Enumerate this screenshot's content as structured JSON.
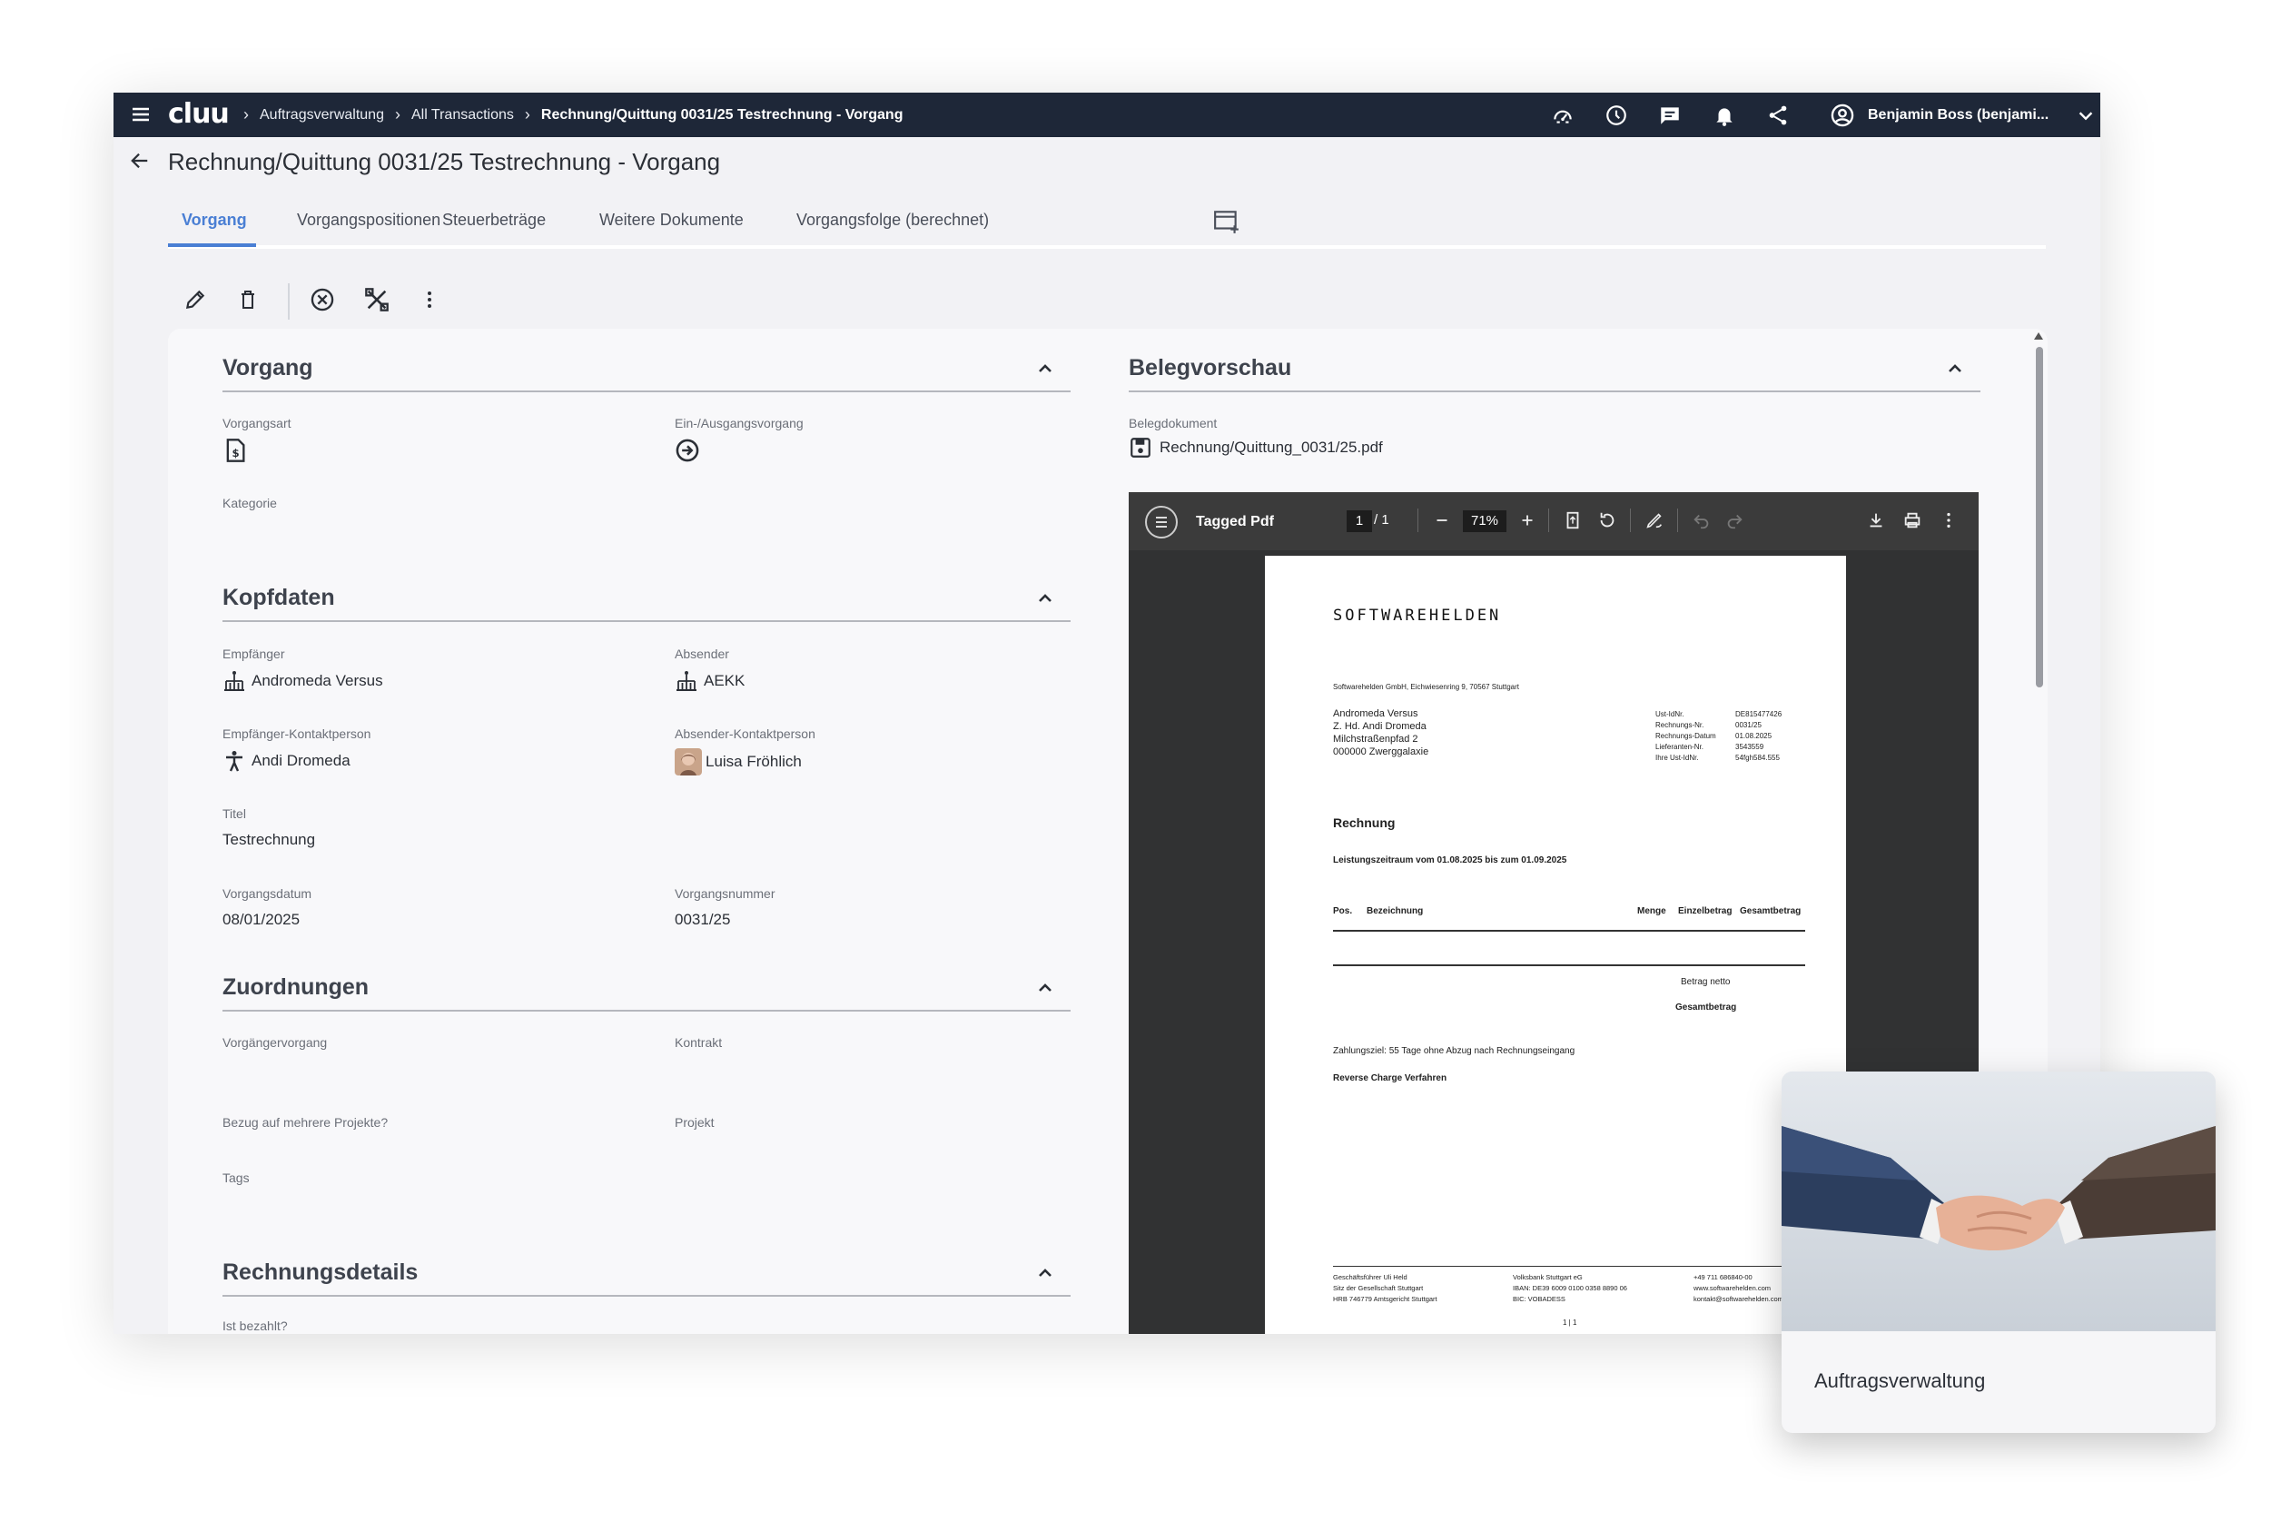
{
  "app": {
    "logo": "cluu",
    "title": "Rechnung/Quittung 0031/25 Testrechnung - Vorgang"
  },
  "breadcrumbs": [
    {
      "label": "Auftragsverwaltung"
    },
    {
      "label": "All Transactions"
    },
    {
      "label": "Rechnung/Quittung 0031/25 Testrechnung - Vorgang"
    }
  ],
  "topbar": {
    "icons": [
      "speedometer-icon",
      "clock-icon",
      "chat-icon",
      "bell-icon",
      "share-icon"
    ],
    "user": "Benjamin Boss (benjami..."
  },
  "tabs": [
    {
      "label": "Vorgang",
      "active": true
    },
    {
      "label": "Vorgangspositionen"
    },
    {
      "label": "Steuerbeträge"
    },
    {
      "label": "Weitere Dokumente"
    },
    {
      "label": "Vorgangsfolge (berechnet)"
    }
  ],
  "toolbar": {
    "actions": [
      "edit-icon",
      "delete-icon",
      "cancel-icon",
      "tools-icon",
      "more-vert-icon"
    ]
  },
  "sections": {
    "vorgang": {
      "title": "Vorgang",
      "vorgangsart_label": "Vorgangsart",
      "ein_ausgang_label": "Ein-/Ausgangsvorgang",
      "kategorie_label": "Kategorie"
    },
    "kopfdaten": {
      "title": "Kopfdaten",
      "empfaenger_label": "Empfänger",
      "empfaenger_value": "Andromeda Versus",
      "absender_label": "Absender",
      "absender_value": "AEKK",
      "empf_kontakt_label": "Empfänger-Kontaktperson",
      "empf_kontakt_value": "Andi Dromeda",
      "abs_kontakt_label": "Absender-Kontaktperson",
      "abs_kontakt_value": "Luisa Fröhlich",
      "titel_label": "Titel",
      "titel_value": "Testrechnung",
      "datum_label": "Vorgangsdatum",
      "datum_value": "08/01/2025",
      "nummer_label": "Vorgangsnummer",
      "nummer_value": "0031/25"
    },
    "zuordnungen": {
      "title": "Zuordnungen",
      "vorgaenger_label": "Vorgängervorgang",
      "kontrakt_label": "Kontrakt",
      "mehrere_projekte_label": "Bezug auf mehrere Projekte?",
      "projekt_label": "Projekt",
      "tags_label": "Tags"
    },
    "rechnungsdetails": {
      "title": "Rechnungsdetails",
      "bezahlt_label": "Ist bezahlt?"
    },
    "belegvorschau": {
      "title": "Belegvorschau",
      "dokument_label": "Belegdokument",
      "dokument_value": "Rechnung/Quittung_0031/25.pdf"
    }
  },
  "pdf_viewer": {
    "name": "Tagged Pdf",
    "page": "1",
    "pages": "/ 1",
    "zoom": "71%"
  },
  "invoice": {
    "brand": "SOFTWAREHELDEN",
    "sender_line": "Softwarehelden GmbH, Eichwiesenring 9, 70567 Stuttgart",
    "address": [
      "Andromeda Versus",
      "Z. Hd. Andi Dromeda",
      "Milchstraßenpfad 2",
      "000000 Zwerggalaxie"
    ],
    "meta_labels": [
      "Ust-IdNr.",
      "Rechnungs-Nr.",
      "Rechnungs-Datum",
      "Lieferanten-Nr.",
      "Ihre Ust-IdNr."
    ],
    "meta_values": [
      "DE815477426",
      "0031/25",
      "01.08.2025",
      "3543559",
      "54fgh584.555"
    ],
    "heading": "Rechnung",
    "period": "Leistungszeitraum vom 01.08.2025 bis zum 01.09.2025",
    "columns": [
      "Pos.",
      "Bezeichnung",
      "Menge",
      "Einzelbetrag",
      "Gesamtbetrag"
    ],
    "net_label": "Betrag netto",
    "total_label": "Gesamtbetrag",
    "payment_terms": "Zahlungsziel: 55 Tage ohne Abzug nach Rechnungseingang",
    "reverse_charge": "Reverse Charge Verfahren",
    "footer_col1": [
      "Geschäftsführer Uli Held",
      "Sitz der Gesellschaft Stuttgart",
      "HRB 746779 Amtsgericht Stuttgart"
    ],
    "footer_col2": [
      "Volksbank Stuttgart eG",
      "IBAN: DE39 6009 0100 0358 8890 06",
      "BIC: VOBADESS"
    ],
    "footer_col3": [
      "+49 711 686840-00",
      "www.softwarehelden.com",
      "kontakt@softwarehelden.com"
    ],
    "page_indicator": "1 | 1"
  },
  "promo_card": {
    "title": "Auftragsverwaltung"
  },
  "colors": {
    "topbar": "#1e2738",
    "accent": "#4a7fd4",
    "background": "#f2f2f5"
  }
}
